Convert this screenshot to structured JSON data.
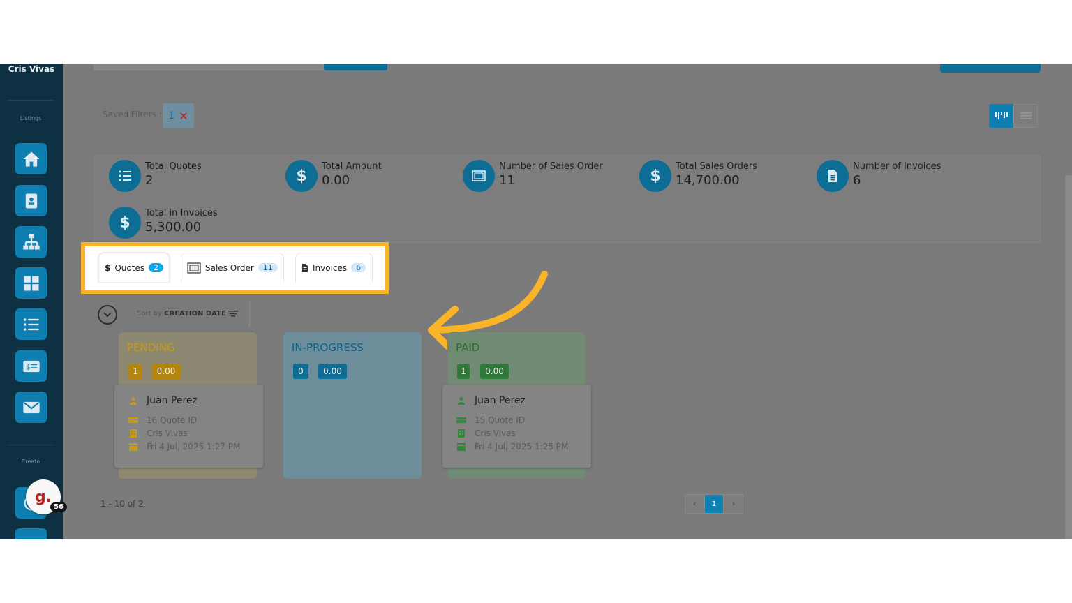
{
  "sidebar": {
    "user_name": "Cris Vivas",
    "listings_label": "Listings",
    "create_label": "Create",
    "items": [
      {
        "icon": "home-icon"
      },
      {
        "icon": "contact-card-icon"
      },
      {
        "icon": "org-chart-icon"
      },
      {
        "icon": "grid-icon"
      },
      {
        "icon": "list-icon"
      },
      {
        "icon": "invoice-icon"
      },
      {
        "icon": "mail-icon"
      }
    ],
    "avatar_letter": "g.",
    "avatar_count": "56"
  },
  "filters": {
    "saved_filters_label": "Saved Filters :",
    "chip_value": "1",
    "chip_remove": "✕"
  },
  "stats": [
    {
      "label": "Total Quotes",
      "value": "2",
      "icon": "list-icon"
    },
    {
      "label": "Total Amount",
      "value": "0.00",
      "icon": "dollar-icon"
    },
    {
      "label": "Number of Sales Order",
      "value": "11",
      "icon": "sales-order-icon"
    },
    {
      "label": "Total Sales Orders",
      "value": "14,700.00",
      "icon": "dollar-icon"
    },
    {
      "label": "Number of Invoices",
      "value": "6",
      "icon": "document-icon"
    },
    {
      "label": "Total in Invoices",
      "value": "5,300.00",
      "icon": "dollar-icon"
    }
  ],
  "tabs": [
    {
      "label": "Quotes",
      "count": "2",
      "prefix": "$",
      "active": true
    },
    {
      "label": "Sales Order",
      "count": "11",
      "active": false
    },
    {
      "label": "Invoices",
      "count": "6",
      "active": false
    }
  ],
  "sort": {
    "prefix": "Sort by",
    "field": "CREATION DATE"
  },
  "columns": [
    {
      "title": "PENDING",
      "count": "1",
      "amount": "0.00",
      "color": "#c99a12"
    },
    {
      "title": "IN-PROGRESS",
      "count": "0",
      "amount": "0.00",
      "color": "#0d6d95"
    },
    {
      "title": "PAID",
      "count": "1",
      "amount": "0.00",
      "color": "#2f8a3a"
    }
  ],
  "cards": [
    {
      "name": "Juan Perez",
      "quote_id": "16 Quote ID",
      "owner": "Cris Vivas",
      "date": "Fri 4 Jul, 2025 1:27 PM",
      "icon_color": "#c99a12"
    },
    {
      "name": "Juan Perez",
      "quote_id": "15 Quote ID",
      "owner": "Cris Vivas",
      "date": "Fri 4 Jul, 2025 1:25 PM",
      "icon_color": "#2f8a3a"
    }
  ],
  "pagination": {
    "summary": "1 - 10 of 2",
    "prev": "‹",
    "current": "1",
    "next": "›"
  },
  "colors": {
    "highlight": "#f9b42a",
    "accent": "#0e7fb0",
    "sidebar": "#0d3142"
  }
}
